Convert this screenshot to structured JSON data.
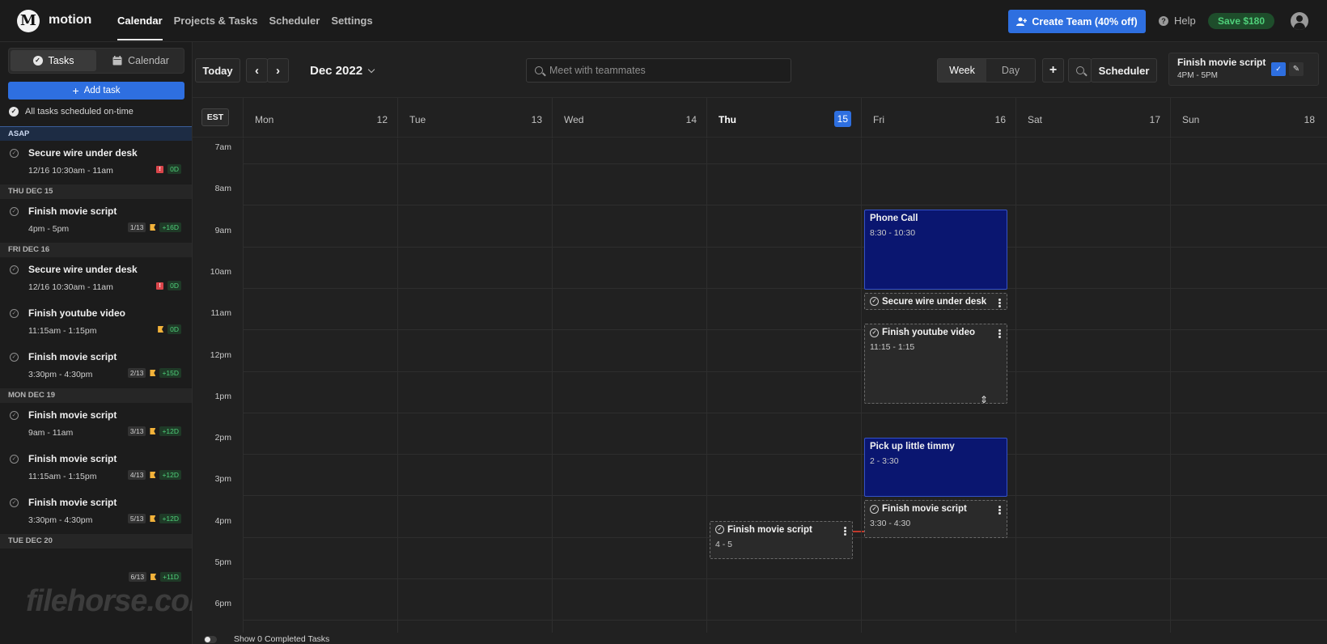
{
  "app": {
    "brand": "motion",
    "logo_glyph": "M",
    "nav": [
      "Calendar",
      "Projects & Tasks",
      "Scheduler",
      "Settings"
    ],
    "create_team": "Create Team (40% off)",
    "help": "Help",
    "save": "Save $180",
    "accent": "#2e6fe0"
  },
  "sidebar": {
    "tabs": [
      "Tasks",
      "Calendar"
    ],
    "add_task": "Add task",
    "all_ok": "All tasks scheduled on-time",
    "groups": [
      {
        "label": "ASAP",
        "tasks": [
          {
            "title": "Secure wire under desk",
            "time": "12/16 10:30am - 11am",
            "chip": "",
            "alert": "!",
            "flag": false,
            "days": "0D"
          }
        ]
      },
      {
        "label": "THU DEC 15",
        "tasks": [
          {
            "title": "Finish movie script",
            "time": "4pm - 5pm",
            "chip": "1/13",
            "alert": "",
            "flag": true,
            "days": "+16D"
          }
        ]
      },
      {
        "label": "FRI DEC 16",
        "tasks": [
          {
            "title": "Secure wire under desk",
            "time": "12/16 10:30am - 11am",
            "chip": "",
            "alert": "!",
            "flag": false,
            "days": "0D"
          },
          {
            "title": "Finish youtube video",
            "time": "11:15am - 1:15pm",
            "chip": "",
            "alert": "",
            "flag": true,
            "days": "0D"
          },
          {
            "title": "Finish movie script",
            "time": "3:30pm - 4:30pm",
            "chip": "2/13",
            "alert": "",
            "flag": true,
            "days": "+15D"
          }
        ]
      },
      {
        "label": "MON DEC 19",
        "tasks": [
          {
            "title": "Finish movie script",
            "time": "9am - 11am",
            "chip": "3/13",
            "alert": "",
            "flag": true,
            "days": "+12D"
          },
          {
            "title": "Finish movie script",
            "time": "11:15am - 1:15pm",
            "chip": "4/13",
            "alert": "",
            "flag": true,
            "days": "+12D"
          },
          {
            "title": "Finish movie script",
            "time": "3:30pm - 4:30pm",
            "chip": "5/13",
            "alert": "",
            "flag": true,
            "days": "+12D"
          }
        ]
      },
      {
        "label": "TUE DEC 20",
        "tasks": [
          {
            "title": "",
            "time": "",
            "chip": "6/13",
            "alert": "",
            "flag": true,
            "days": "+11D"
          }
        ]
      }
    ],
    "watermark": "filehorse.com"
  },
  "toolbar": {
    "today": "Today",
    "prev": "‹",
    "next": "›",
    "month": "Dec 2022",
    "search_placeholder": "Meet with teammates",
    "views": [
      "Week",
      "Day"
    ],
    "add": "+",
    "scheduler": "Scheduler",
    "next_task": {
      "title": "Finish movie script",
      "time": "4PM - 5PM",
      "confirm_glyph": "✓",
      "edit_glyph": "✎"
    }
  },
  "calendar": {
    "timezone": "EST",
    "days": [
      {
        "name": "Mon",
        "date": "12",
        "today": false
      },
      {
        "name": "Tue",
        "date": "13",
        "today": false
      },
      {
        "name": "Wed",
        "date": "14",
        "today": false
      },
      {
        "name": "Thu",
        "date": "15",
        "today": true
      },
      {
        "name": "Fri",
        "date": "16",
        "today": false
      },
      {
        "name": "Sat",
        "date": "17",
        "today": false
      },
      {
        "name": "Sun",
        "date": "18",
        "today": false
      }
    ],
    "hours": [
      "7am",
      "8am",
      "9am",
      "10am",
      "11am",
      "12pm",
      "1pm",
      "2pm",
      "3pm",
      "4pm",
      "5pm",
      "6pm"
    ],
    "first_hour": 7,
    "events": [
      {
        "title": "Phone Call",
        "time": "8:30 - 10:30",
        "day": 4,
        "start": 8.5,
        "end": 10.5,
        "kind": "event"
      },
      {
        "title": "Secure wire under desk",
        "time": "",
        "day": 4,
        "start": 10.5,
        "end": 11,
        "kind": "task"
      },
      {
        "title": "Finish youtube video",
        "time": "11:15 - 1:15",
        "day": 4,
        "start": 11.25,
        "end": 13.25,
        "kind": "task"
      },
      {
        "title": "Pick up little timmy",
        "time": "2 - 3:30",
        "day": 4,
        "start": 14,
        "end": 15.5,
        "kind": "event"
      },
      {
        "title": "Finish movie script",
        "time": "3:30 - 4:30",
        "day": 4,
        "start": 15.5,
        "end": 16.5,
        "kind": "task"
      },
      {
        "title": "Finish movie script",
        "time": "4 - 5",
        "day": 3,
        "start": 16,
        "end": 17,
        "kind": "task"
      }
    ],
    "colors": {
      "event_bg": "#0a1670",
      "event_border": "#3552c9",
      "now_line": "#c0392b"
    }
  },
  "footer": {
    "show_completed": "Show 0 Completed Tasks"
  }
}
